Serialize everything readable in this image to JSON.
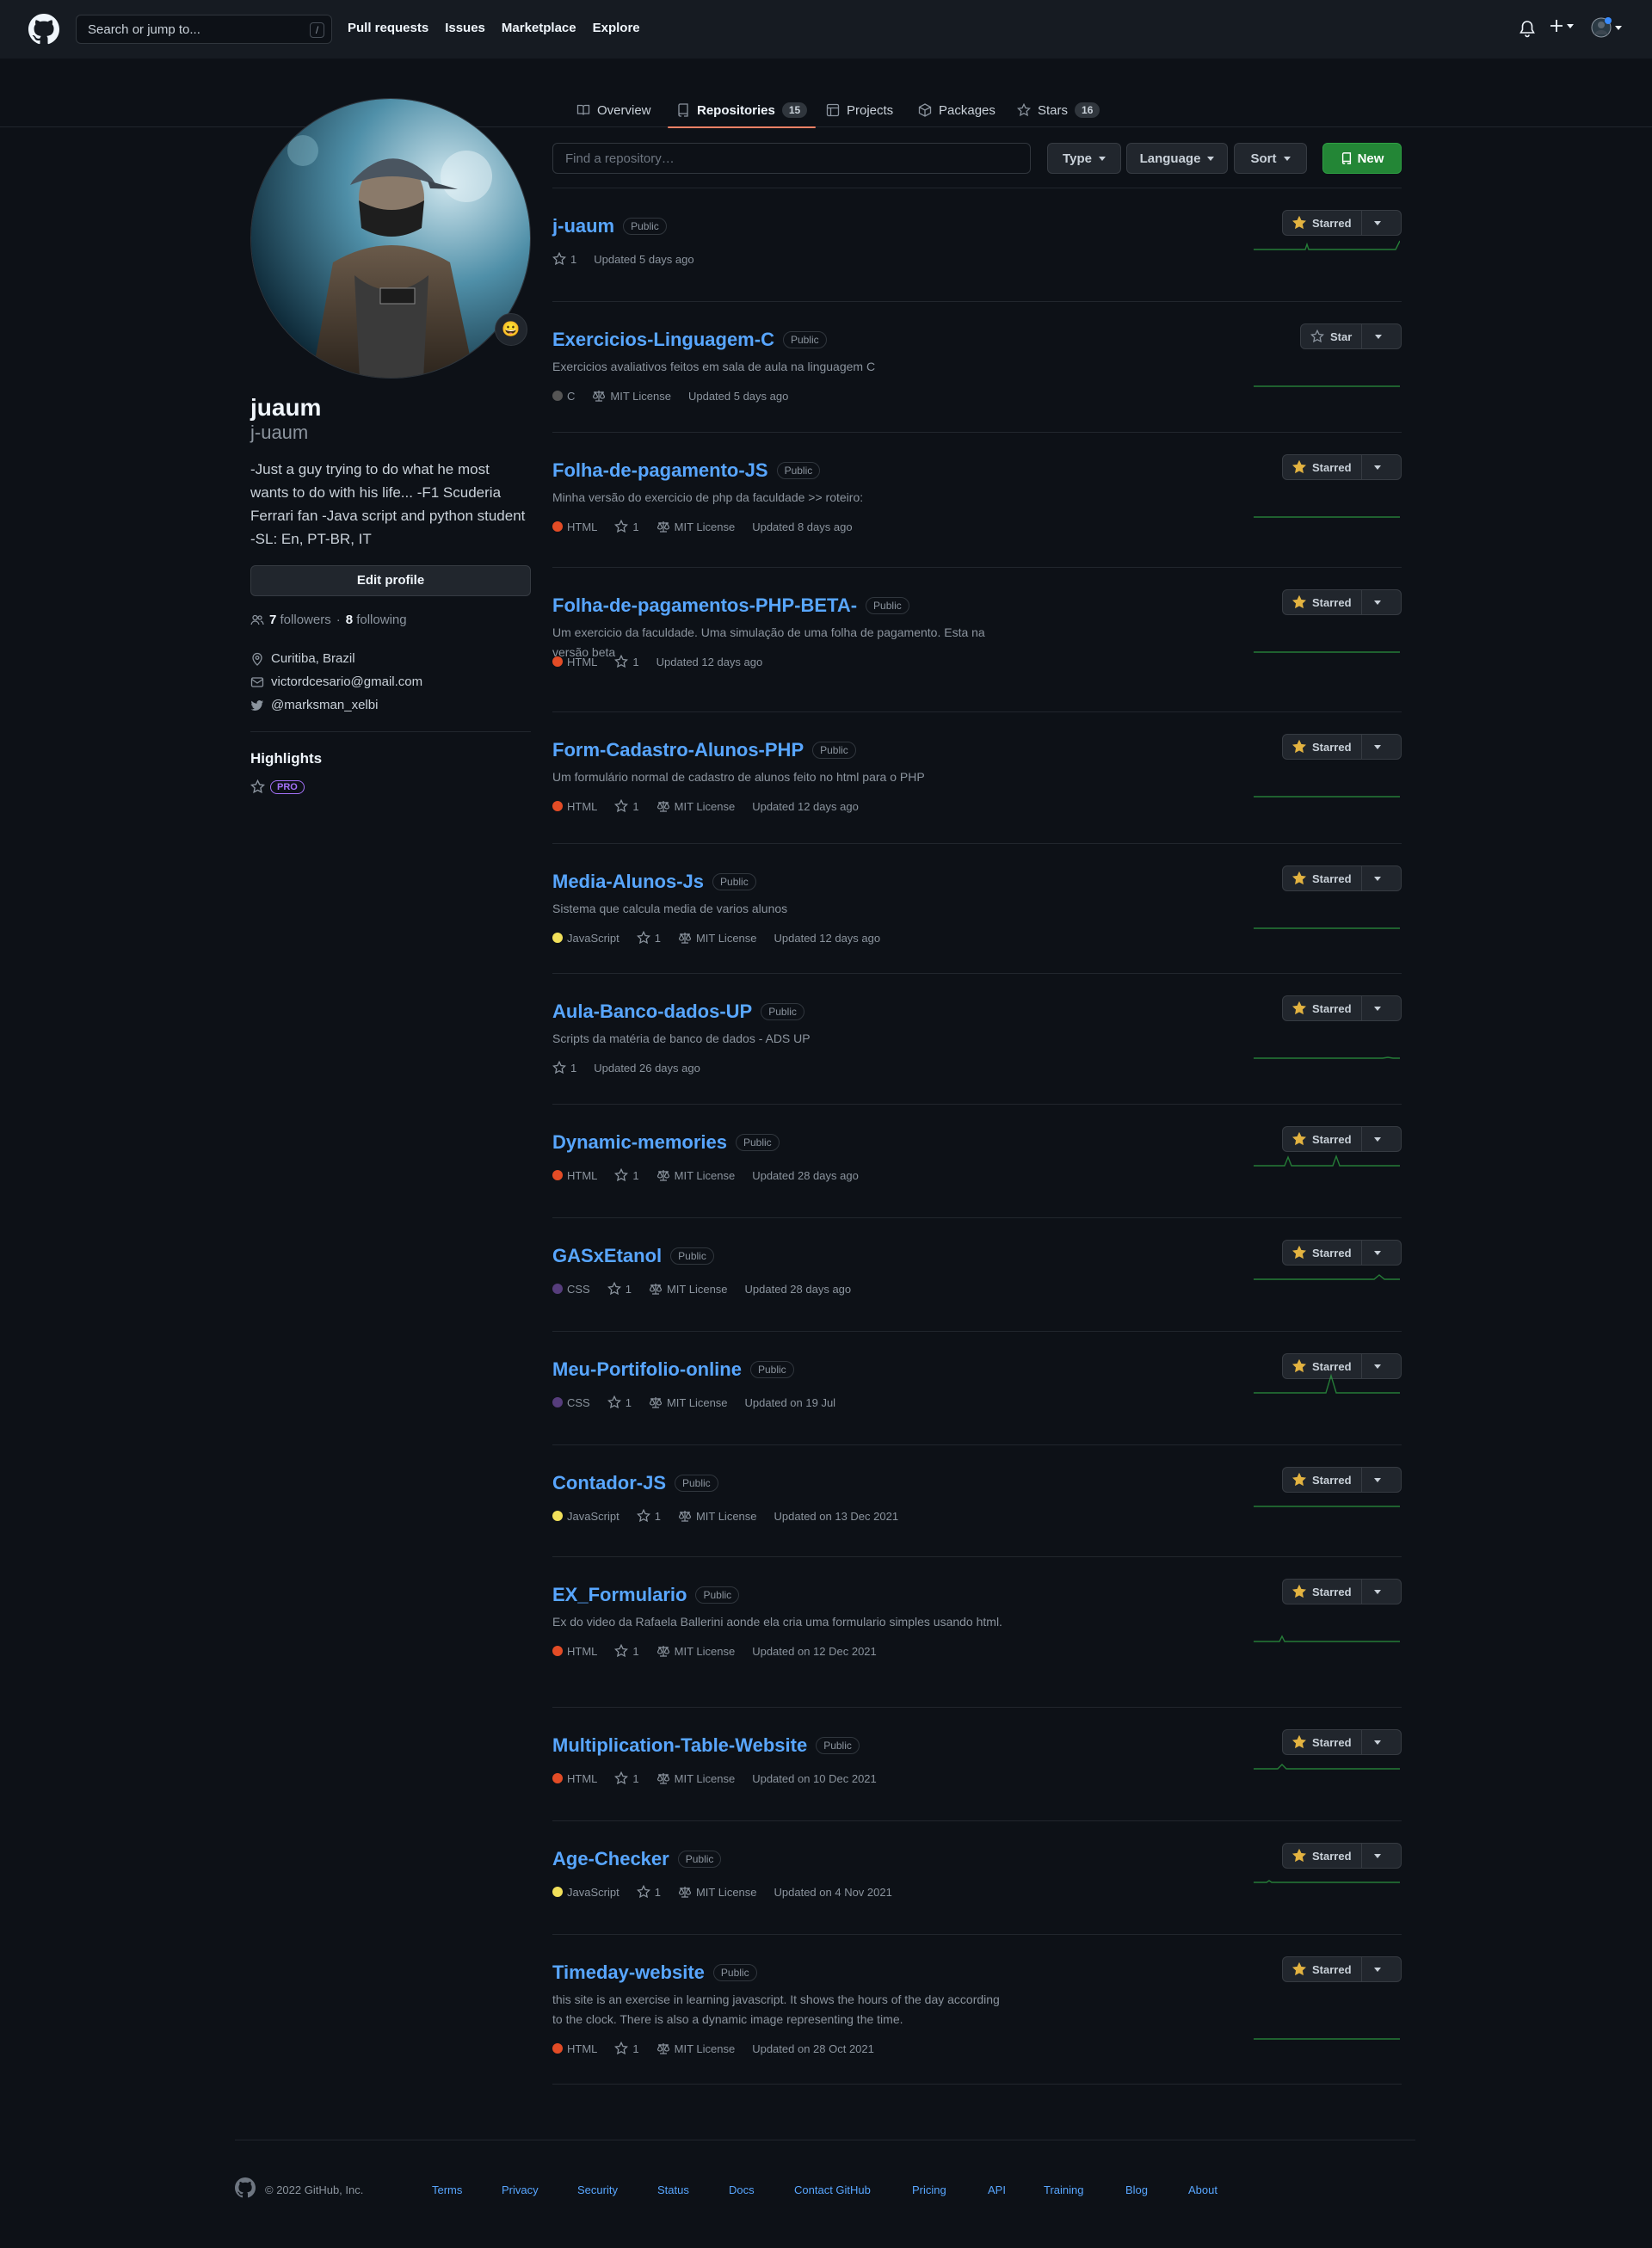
{
  "header": {
    "search_placeholder": "Search or jump to...",
    "search_shortcut": "/",
    "nav": [
      "Pull requests",
      "Issues",
      "Marketplace",
      "Explore"
    ]
  },
  "tabs": [
    {
      "label": "Overview",
      "icon": "book-icon"
    },
    {
      "label": "Repositories",
      "count": "15",
      "icon": "repo-icon",
      "selected": true
    },
    {
      "label": "Projects",
      "icon": "table-icon"
    },
    {
      "label": "Packages",
      "icon": "package-icon"
    },
    {
      "label": "Stars",
      "count": "16",
      "icon": "star-icon"
    }
  ],
  "profile": {
    "name": "juaum",
    "login": "j-uaum",
    "bio": "-Just a guy trying to do what he most wants to do with his life... -F1 Scuderia Ferrari fan -Java script and python student -SL: En, PT-BR, IT",
    "edit_label": "Edit profile",
    "followers": "7",
    "followers_label": "followers",
    "sep": "·",
    "following": "8",
    "following_label": "following",
    "location": "Curitiba, Brazil",
    "email": "victordcesario@gmail.com",
    "twitter": "@marksman_xelbi",
    "highlights_title": "Highlights",
    "pro_badge": "PRO",
    "status_emoji": "😀"
  },
  "filters": {
    "find_placeholder": "Find a repository…",
    "type": "Type",
    "language": "Language",
    "sort": "Sort",
    "new": "New"
  },
  "languages": {
    "HTML": "#e34c26",
    "C": "#555555",
    "JavaScript": "#f1e05a",
    "CSS": "#563d7c"
  },
  "repos": [
    {
      "name": "j-uaum",
      "visibility": "Public",
      "description": "",
      "language": "",
      "stars": "1",
      "license": "",
      "updated": "Updated 5 days ago",
      "star_label": "Starred",
      "starred": true
    },
    {
      "name": "Exercicios-Linguagem-C",
      "visibility": "Public",
      "description": "Exercicios avaliativos feitos em sala de aula na linguagem C",
      "language": "C",
      "stars": "",
      "license": "MIT License",
      "updated": "Updated 5 days ago",
      "star_label": "Star",
      "starred": false
    },
    {
      "name": "Folha-de-pagamento-JS",
      "visibility": "Public",
      "description": "Minha versão do exercicio de php da faculdade >> roteiro:",
      "language": "HTML",
      "stars": "1",
      "license": "MIT License",
      "updated": "Updated 8 days ago",
      "star_label": "Starred",
      "starred": true
    },
    {
      "name": "Folha-de-pagamentos-PHP-BETA-",
      "visibility": "Public",
      "description": "Um exercicio da faculdade. Uma simulação de uma folha de pagamento. Esta na versão beta",
      "language": "HTML",
      "stars": "1",
      "license": "",
      "updated": "Updated 12 days ago",
      "star_label": "Starred",
      "starred": true
    },
    {
      "name": "Form-Cadastro-Alunos-PHP",
      "visibility": "Public",
      "description": "Um formulário normal de cadastro de alunos feito no html para o PHP",
      "language": "HTML",
      "stars": "1",
      "license": "MIT License",
      "updated": "Updated 12 days ago",
      "star_label": "Starred",
      "starred": true
    },
    {
      "name": "Media-Alunos-Js",
      "visibility": "Public",
      "description": "Sistema que calcula media de varios alunos",
      "language": "JavaScript",
      "stars": "1",
      "license": "MIT License",
      "updated": "Updated 12 days ago",
      "star_label": "Starred",
      "starred": true
    },
    {
      "name": "Aula-Banco-dados-UP",
      "visibility": "Public",
      "description": "Scripts da matéria de banco de dados - ADS UP",
      "language": "",
      "stars": "1",
      "license": "",
      "updated": "Updated 26 days ago",
      "star_label": "Starred",
      "starred": true
    },
    {
      "name": "Dynamic-memories",
      "visibility": "Public",
      "description": "",
      "language": "HTML",
      "stars": "1",
      "license": "MIT License",
      "updated": "Updated 28 days ago",
      "star_label": "Starred",
      "starred": true
    },
    {
      "name": "GASxEtanol",
      "visibility": "Public",
      "description": "",
      "language": "CSS",
      "stars": "1",
      "license": "MIT License",
      "updated": "Updated 28 days ago",
      "star_label": "Starred",
      "starred": true
    },
    {
      "name": "Meu-Portifolio-online",
      "visibility": "Public",
      "description": "",
      "language": "CSS",
      "stars": "1",
      "license": "MIT License",
      "updated": "Updated on 19 Jul",
      "star_label": "Starred",
      "starred": true
    },
    {
      "name": "Contador-JS",
      "visibility": "Public",
      "description": "",
      "language": "JavaScript",
      "stars": "1",
      "license": "MIT License",
      "updated": "Updated on 13 Dec 2021",
      "star_label": "Starred",
      "starred": true
    },
    {
      "name": "EX_Formulario",
      "visibility": "Public",
      "description": "Ex do video da Rafaela Ballerini aonde ela cria uma formulario simples usando html.",
      "language": "HTML",
      "stars": "1",
      "license": "MIT License",
      "updated": "Updated on 12 Dec 2021",
      "star_label": "Starred",
      "starred": true
    },
    {
      "name": "Multiplication-Table-Website",
      "visibility": "Public",
      "description": "",
      "language": "HTML",
      "stars": "1",
      "license": "MIT License",
      "updated": "Updated on 10 Dec 2021",
      "star_label": "Starred",
      "starred": true
    },
    {
      "name": "Age-Checker",
      "visibility": "Public",
      "description": "",
      "language": "JavaScript",
      "stars": "1",
      "license": "MIT License",
      "updated": "Updated on 4 Nov 2021",
      "star_label": "Starred",
      "starred": true
    },
    {
      "name": "Timeday-website",
      "visibility": "Public",
      "description": "this site is an exercise in learning javascript. It shows the hours of the day according to the clock. There is also a dynamic image representing the time.",
      "language": "HTML",
      "stars": "1",
      "license": "MIT License",
      "updated": "Updated on 28 Oct 2021",
      "star_label": "Starred",
      "starred": true
    }
  ],
  "footer": {
    "copyright": "© 2022 GitHub, Inc.",
    "links": [
      "Terms",
      "Privacy",
      "Security",
      "Status",
      "Docs",
      "Contact GitHub",
      "Pricing",
      "API",
      "Training",
      "Blog",
      "About"
    ]
  },
  "colors": {
    "accent": "#58a6ff",
    "tab_underline": "#f78166",
    "new_button": "#238636",
    "star": "#e3b341",
    "sparkline": "#2ea043",
    "pro": "#a371f7"
  }
}
